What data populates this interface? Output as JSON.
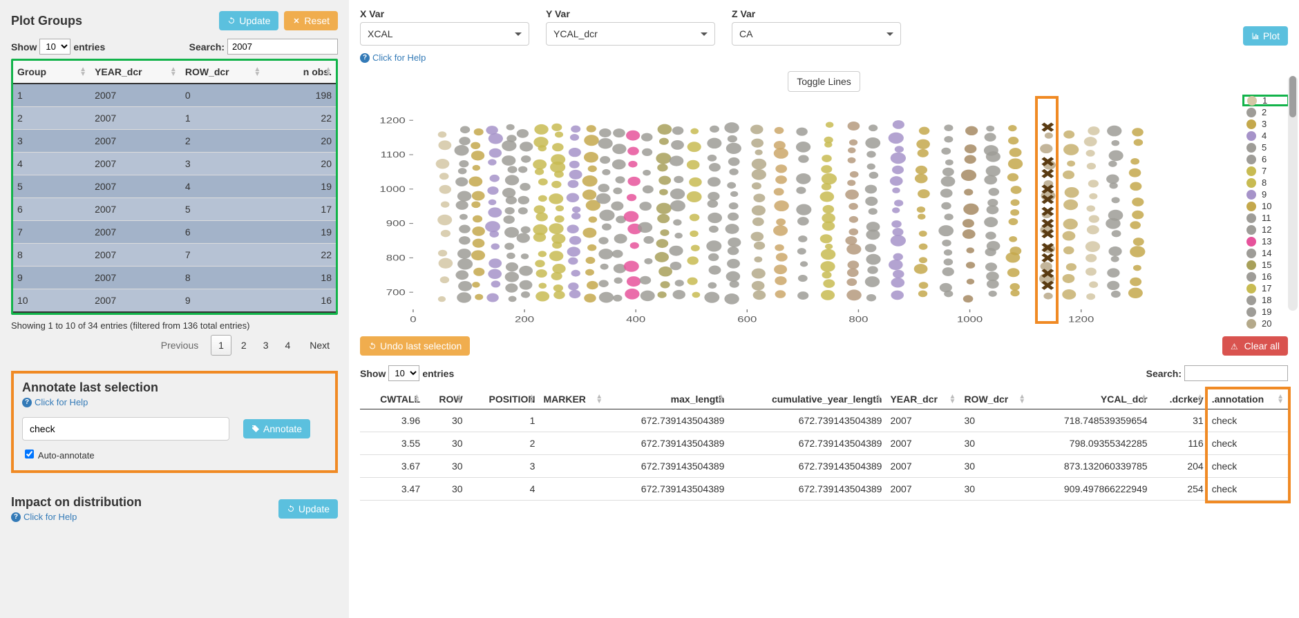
{
  "left": {
    "title": "Plot Groups",
    "update_label": "Update",
    "reset_label": "Reset",
    "show_label_pre": "Show",
    "show_label_post": "entries",
    "page_len": "10",
    "search_label": "Search:",
    "search_value": "2007",
    "columns": [
      "Group",
      "YEAR_dcr",
      "ROW_dcr",
      "n obs."
    ],
    "rows": [
      {
        "group": "1",
        "year": "2007",
        "row": "0",
        "n": "198"
      },
      {
        "group": "2",
        "year": "2007",
        "row": "1",
        "n": "22"
      },
      {
        "group": "3",
        "year": "2007",
        "row": "2",
        "n": "20"
      },
      {
        "group": "4",
        "year": "2007",
        "row": "3",
        "n": "20"
      },
      {
        "group": "5",
        "year": "2007",
        "row": "4",
        "n": "19"
      },
      {
        "group": "6",
        "year": "2007",
        "row": "5",
        "n": "17"
      },
      {
        "group": "7",
        "year": "2007",
        "row": "6",
        "n": "19"
      },
      {
        "group": "8",
        "year": "2007",
        "row": "7",
        "n": "22"
      },
      {
        "group": "9",
        "year": "2007",
        "row": "8",
        "n": "18"
      },
      {
        "group": "10",
        "year": "2007",
        "row": "9",
        "n": "16"
      }
    ],
    "info": "Showing 1 to 10 of 34 entries (filtered from 136 total entries)",
    "paginate": {
      "prev": "Previous",
      "next": "Next",
      "pages": [
        "1",
        "2",
        "3",
        "4"
      ],
      "current": "1"
    },
    "annotate": {
      "title": "Annotate last selection",
      "help": "Click for Help",
      "value": "check",
      "button": "Annotate",
      "auto": "Auto-annotate"
    },
    "impact": {
      "title": "Impact on distribution",
      "help": "Click for Help",
      "update": "Update"
    }
  },
  "right": {
    "vars": {
      "x": {
        "label": "X Var",
        "value": "XCAL"
      },
      "y": {
        "label": "Y Var",
        "value": "YCAL_dcr"
      },
      "z": {
        "label": "Z Var",
        "value": "CA"
      }
    },
    "plot_btn": "Plot",
    "help": "Click for Help",
    "toggle": "Toggle Lines",
    "legend": [
      "1",
      "2",
      "3",
      "4",
      "5",
      "6",
      "7",
      "8",
      "9",
      "10",
      "11",
      "12",
      "13",
      "14",
      "15",
      "16",
      "17",
      "18",
      "19",
      "20"
    ],
    "legend_colors": [
      "#d4c7a5",
      "#9e9c97",
      "#c4a84c",
      "#a693c9",
      "#9e9c97",
      "#9e9c97",
      "#c8bb52",
      "#c8bb52",
      "#a693c9",
      "#c4a84c",
      "#9e9c97",
      "#9e9c97",
      "#e6539b",
      "#9e9c97",
      "#a8a05a",
      "#9e9c97",
      "#c8bb52",
      "#9e9c97",
      "#9e9c97",
      "#b4a98a"
    ],
    "undo": "Undo last selection",
    "clear": "Clear all",
    "show_label_pre": "Show",
    "show_label_post": "entries",
    "page_len": "10",
    "search_label": "Search:",
    "search_value": "",
    "columns": [
      "CWTALL",
      "ROW",
      "POSITION",
      "MARKER",
      "max_length",
      "cumulative_year_length",
      "YEAR_dcr",
      "ROW_dcr",
      "YCAL_dcr",
      ".dcrkey",
      ".annotation"
    ],
    "rows": [
      {
        "cw": "3.96",
        "row": "30",
        "pos": "1",
        "marker": "",
        "maxl": "672.739143504389",
        "cyl": "672.739143504389",
        "year": "2007",
        "rowd": "30",
        "ycal": "718.748539359654",
        "key": "31",
        "ann": "check"
      },
      {
        "cw": "3.55",
        "row": "30",
        "pos": "2",
        "marker": "",
        "maxl": "672.739143504389",
        "cyl": "672.739143504389",
        "year": "2007",
        "rowd": "30",
        "ycal": "798.09355342285",
        "key": "116",
        "ann": "check"
      },
      {
        "cw": "3.67",
        "row": "30",
        "pos": "3",
        "marker": "",
        "maxl": "672.739143504389",
        "cyl": "672.739143504389",
        "year": "2007",
        "rowd": "30",
        "ycal": "873.132060339785",
        "key": "204",
        "ann": "check"
      },
      {
        "cw": "3.47",
        "row": "30",
        "pos": "4",
        "marker": "",
        "maxl": "672.739143504389",
        "cyl": "672.739143504389",
        "year": "2007",
        "rowd": "30",
        "ycal": "909.497866222949",
        "key": "254",
        "ann": "check"
      }
    ]
  },
  "chart_data": {
    "type": "scatter",
    "xlabel": "",
    "ylabel": "",
    "xlim": [
      0,
      1450
    ],
    "ylim": [
      650,
      1250
    ],
    "xticks": [
      0,
      200,
      400,
      600,
      800,
      1000,
      1200
    ],
    "yticks": [
      700,
      800,
      900,
      1000,
      1100,
      1200
    ],
    "selected_column_x": 1140,
    "series_colors": [
      "#d4c7a5",
      "#9e9c97",
      "#c4a84c",
      "#a693c9",
      "#9e9c97",
      "#9e9c97",
      "#c8bb52",
      "#c8bb52",
      "#a693c9",
      "#c4a84c",
      "#9e9c97",
      "#9e9c97",
      "#e6539b",
      "#9e9c97",
      "#a8a05a",
      "#9e9c97",
      "#c8bb52",
      "#9e9c97",
      "#9e9c97",
      "#b4a98a",
      "#cba76a",
      "#9e9c97",
      "#c8bb52",
      "#b59a7e",
      "#9e9c97",
      "#a693c9",
      "#c4a84c",
      "#9e9c97",
      "#a68a63",
      "#9e9c97",
      "#c4a84c",
      "#b8a888",
      "#c7b06e"
    ],
    "columns_x": [
      55,
      90,
      115,
      145,
      175,
      200,
      230,
      260,
      290,
      320,
      345,
      370,
      395,
      420,
      450,
      475,
      505,
      540,
      575,
      620,
      660,
      700,
      745,
      790,
      825,
      870,
      915,
      960,
      1000,
      1040,
      1080,
      1140,
      1180,
      1220,
      1260,
      1300
    ],
    "col_count": [
      12,
      16,
      14,
      15,
      17,
      13,
      16,
      18,
      16,
      14,
      13,
      12,
      11,
      10,
      14,
      12,
      11,
      14,
      16,
      15,
      14,
      12,
      18,
      16,
      15,
      17,
      14,
      16,
      12,
      17,
      15,
      11,
      12,
      14,
      15,
      13
    ],
    "selected_points_y": [
      720,
      755,
      800,
      830,
      870,
      900,
      935,
      970,
      1000,
      1045,
      1080,
      1180
    ]
  }
}
